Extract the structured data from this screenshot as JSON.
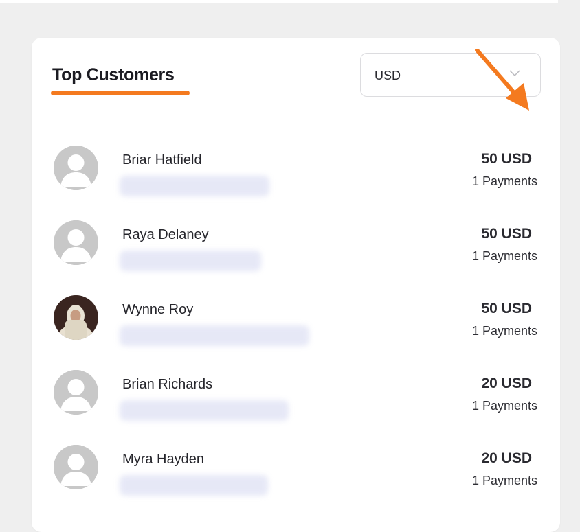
{
  "colors": {
    "accent": "#f47a1f",
    "avatar_placeholder": "#c8c8c8"
  },
  "widget": {
    "title": "Top Customers",
    "currency_select": {
      "selected": "USD",
      "icon": "chevron-down-icon"
    }
  },
  "customers": [
    {
      "name": "Briar Hatfield",
      "amount": "50 USD",
      "payments": "1 Payments",
      "avatar": "default-avatar-icon"
    },
    {
      "name": "Raya Delaney",
      "amount": "50 USD",
      "payments": "1 Payments",
      "avatar": "default-avatar-icon"
    },
    {
      "name": "Wynne Roy",
      "amount": "50 USD",
      "payments": "1 Payments",
      "avatar": "photo"
    },
    {
      "name": "Brian Richards",
      "amount": "20 USD",
      "payments": "1 Payments",
      "avatar": "default-avatar-icon"
    },
    {
      "name": "Myra Hayden",
      "amount": "20 USD",
      "payments": "1 Payments",
      "avatar": "default-avatar-icon"
    }
  ]
}
